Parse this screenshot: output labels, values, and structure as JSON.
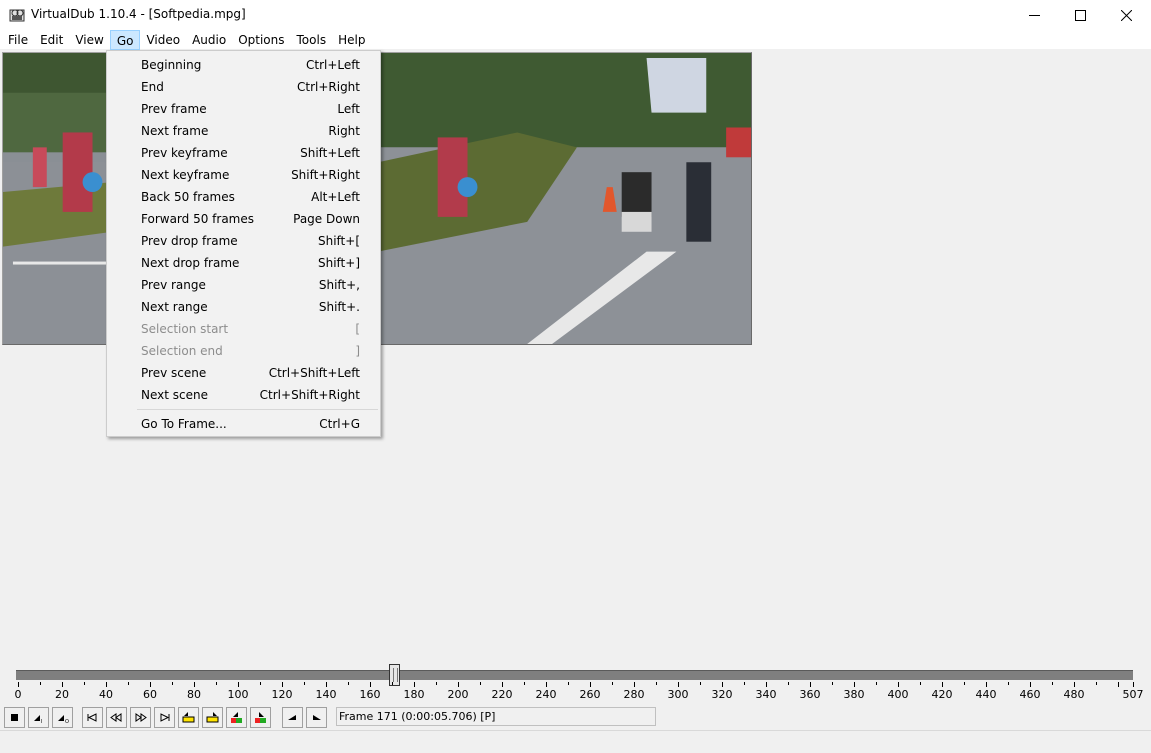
{
  "window": {
    "title": "VirtualDub 1.10.4 - [Softpedia.mpg]"
  },
  "menubar": {
    "items": [
      "File",
      "Edit",
      "View",
      "Go",
      "Video",
      "Audio",
      "Options",
      "Tools",
      "Help"
    ],
    "active": "Go"
  },
  "go_menu": {
    "items": [
      {
        "label": "Beginning",
        "shortcut": "Ctrl+Left",
        "enabled": true
      },
      {
        "label": "End",
        "shortcut": "Ctrl+Right",
        "enabled": true
      },
      {
        "label": "Prev frame",
        "shortcut": "Left",
        "enabled": true
      },
      {
        "label": "Next frame",
        "shortcut": "Right",
        "enabled": true
      },
      {
        "label": "Prev keyframe",
        "shortcut": "Shift+Left",
        "enabled": true
      },
      {
        "label": "Next keyframe",
        "shortcut": "Shift+Right",
        "enabled": true
      },
      {
        "label": "Back 50 frames",
        "shortcut": "Alt+Left",
        "enabled": true
      },
      {
        "label": "Forward 50 frames",
        "shortcut": "Page Down",
        "enabled": true
      },
      {
        "label": "Prev drop frame",
        "shortcut": "Shift+[",
        "enabled": true
      },
      {
        "label": "Next drop frame",
        "shortcut": "Shift+]",
        "enabled": true
      },
      {
        "label": "Prev range",
        "shortcut": "Shift+,",
        "enabled": true
      },
      {
        "label": "Next range",
        "shortcut": "Shift+.",
        "enabled": true
      },
      {
        "label": "Selection start",
        "shortcut": "[",
        "enabled": false
      },
      {
        "label": "Selection end",
        "shortcut": "]",
        "enabled": false
      },
      {
        "label": "Prev scene",
        "shortcut": "Ctrl+Shift+Left",
        "enabled": true
      },
      {
        "label": "Next scene",
        "shortcut": "Ctrl+Shift+Right",
        "enabled": true
      }
    ],
    "goto": {
      "label": "Go To Frame...",
      "shortcut": "Ctrl+G"
    }
  },
  "timeline": {
    "min": 0,
    "max": 507,
    "current": 171,
    "tick_labels": [
      "0",
      "20",
      "40",
      "60",
      "80",
      "100",
      "120",
      "140",
      "160",
      "180",
      "200",
      "220",
      "240",
      "260",
      "280",
      "300",
      "320",
      "340",
      "360",
      "380",
      "400",
      "420",
      "440",
      "460",
      "480",
      "507"
    ]
  },
  "status": {
    "frame_info": "Frame 171 (0:00:05.706) [P]"
  },
  "toolbar": {
    "icons": [
      "stop-icon",
      "play-input-icon",
      "play-output-icon",
      "go-start-icon",
      "prev-frame-icon",
      "next-frame-icon",
      "go-end-icon",
      "prev-keyframe-icon",
      "next-keyframe-icon",
      "prev-scene-icon",
      "next-scene-icon",
      "mark-in-icon",
      "mark-out-icon"
    ]
  },
  "colors": {
    "menu_highlight": "#cce8ff",
    "disabled_text": "#8d8d8d"
  }
}
